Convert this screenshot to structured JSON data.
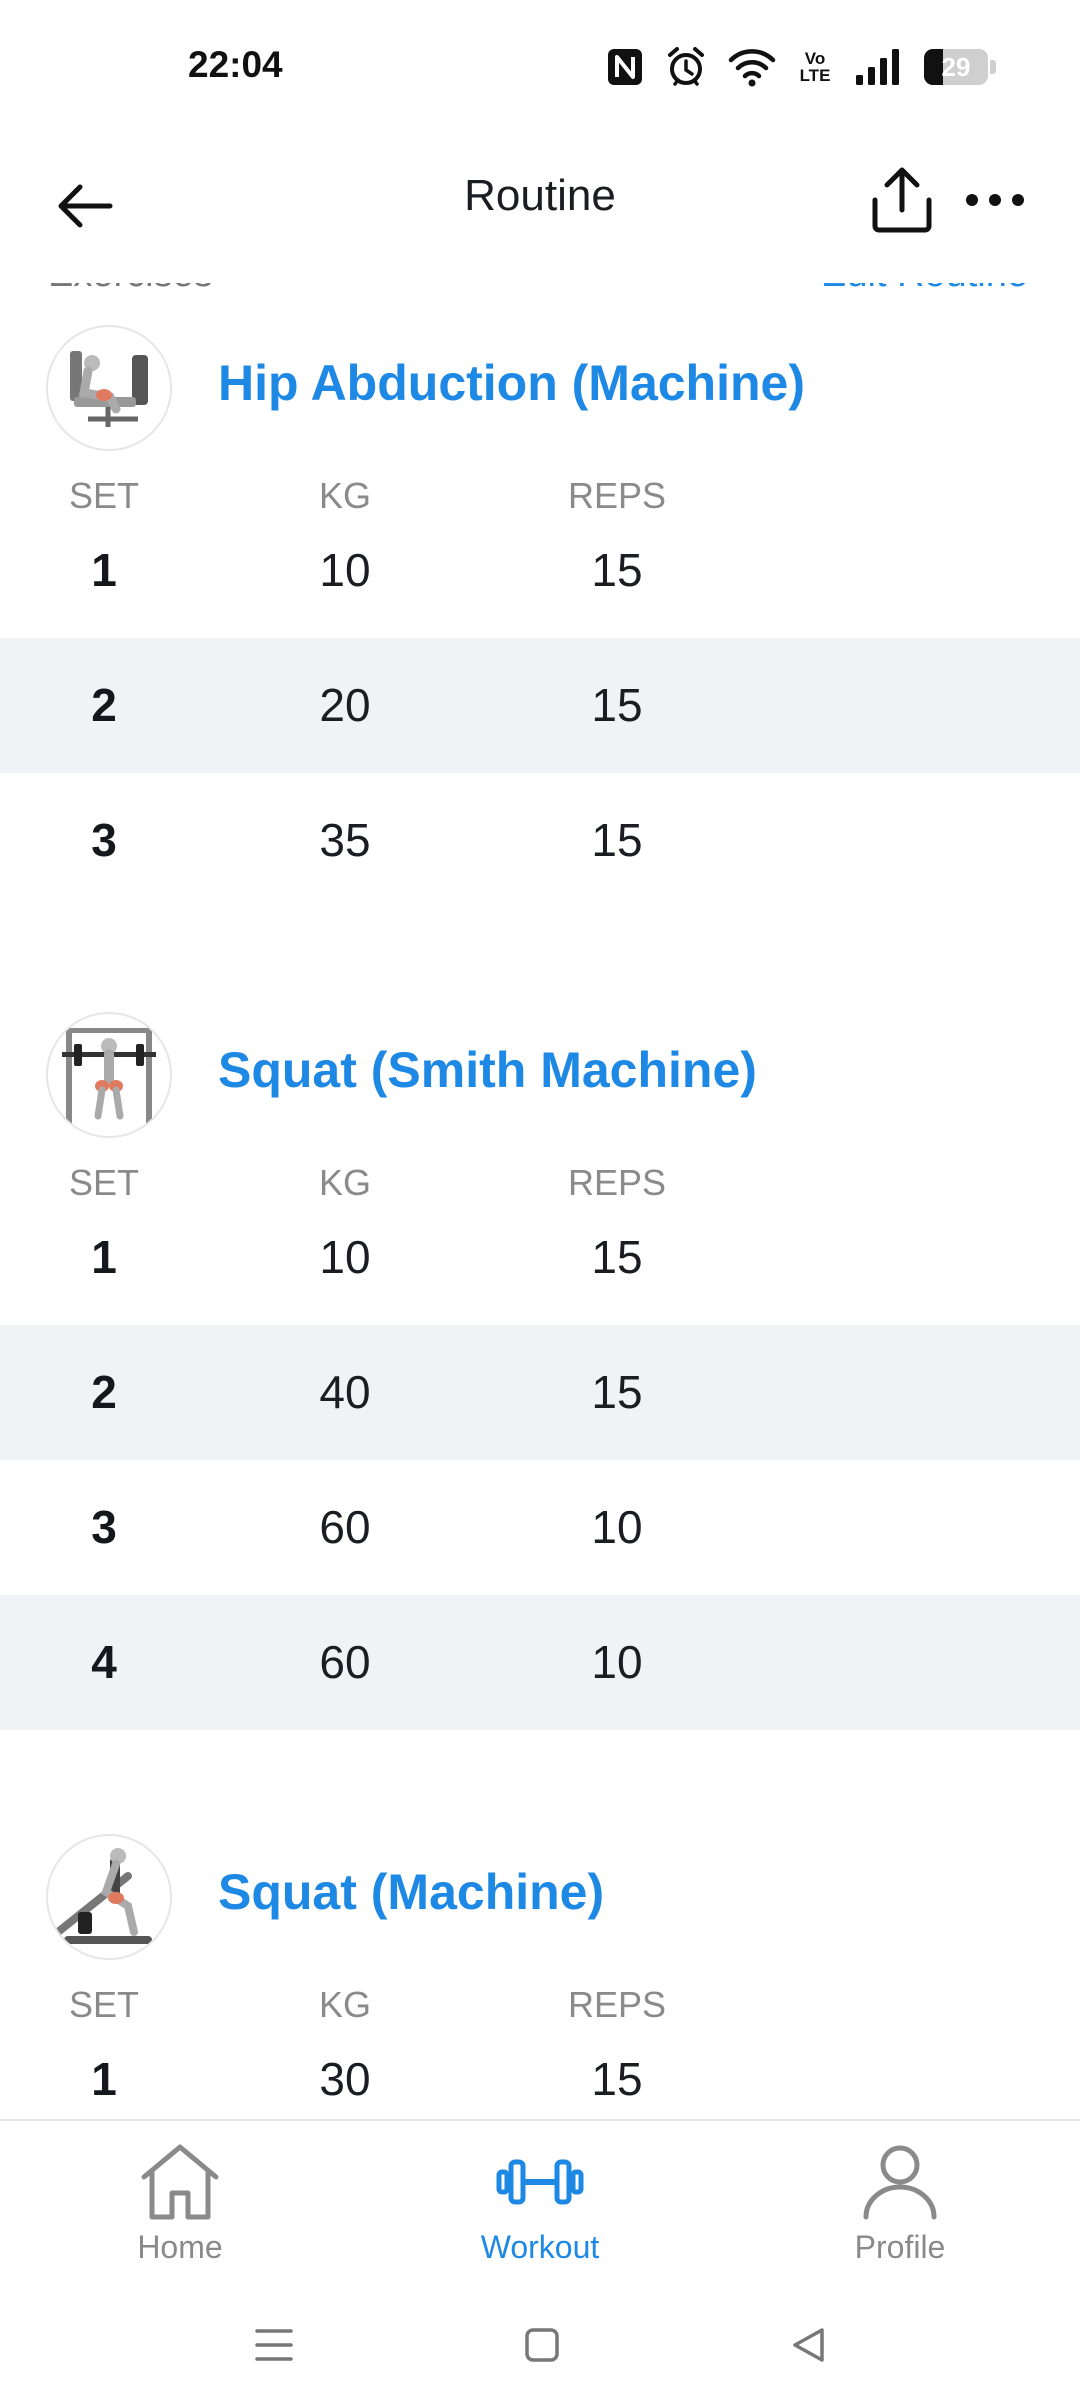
{
  "status_bar": {
    "time": "22:04",
    "battery_level": "29",
    "icons": [
      "nfc-icon",
      "alarm-icon",
      "wifi-icon",
      "volte-icon",
      "signal-icon",
      "battery-icon"
    ],
    "volte_label": "Vo LTE"
  },
  "header": {
    "title": "Routine",
    "back_icon": "arrow-left-icon",
    "share_icon": "share-icon",
    "more_icon": "more-horizontal-icon"
  },
  "section": {
    "label": "Exercises",
    "edit_label": "Edit Routine"
  },
  "columns": {
    "set": "SET",
    "kg": "KG",
    "reps": "REPS"
  },
  "exercises": [
    {
      "name": "Hip Abduction (Machine)",
      "sets": [
        {
          "set": "1",
          "kg": "10",
          "reps": "15"
        },
        {
          "set": "2",
          "kg": "20",
          "reps": "15"
        },
        {
          "set": "3",
          "kg": "35",
          "reps": "15"
        }
      ]
    },
    {
      "name": "Squat (Smith Machine)",
      "sets": [
        {
          "set": "1",
          "kg": "10",
          "reps": "15"
        },
        {
          "set": "2",
          "kg": "40",
          "reps": "15"
        },
        {
          "set": "3",
          "kg": "60",
          "reps": "10"
        },
        {
          "set": "4",
          "kg": "60",
          "reps": "10"
        }
      ]
    },
    {
      "name": "Squat (Machine)",
      "sets": [
        {
          "set": "1",
          "kg": "30",
          "reps": "15"
        }
      ]
    }
  ],
  "tabbar": {
    "home": "Home",
    "workout": "Workout",
    "profile": "Profile",
    "active": "workout"
  },
  "colors": {
    "accent": "#1e88e5",
    "text": "#1b1d22",
    "muted": "#8a8a8a",
    "row_alt": "#f1f2f6"
  }
}
